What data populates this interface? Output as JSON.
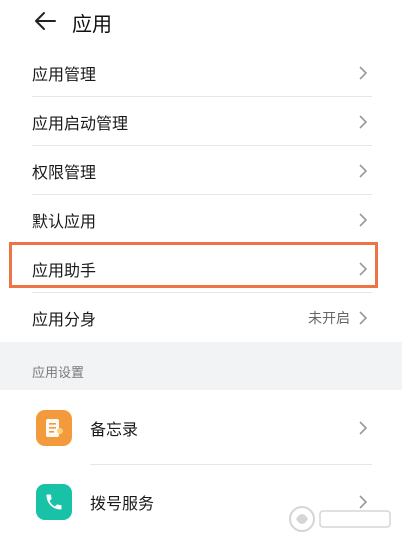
{
  "header": {
    "title": "应用",
    "back_icon": "arrow-left-icon"
  },
  "menu": {
    "items": [
      {
        "label": "应用管理",
        "value": ""
      },
      {
        "label": "应用启动管理",
        "value": ""
      },
      {
        "label": "权限管理",
        "value": ""
      },
      {
        "label": "默认应用",
        "value": ""
      },
      {
        "label": "应用助手",
        "value": "",
        "highlighted": true
      },
      {
        "label": "应用分身",
        "value": "未开启"
      }
    ]
  },
  "section": {
    "title": "应用设置"
  },
  "apps": [
    {
      "label": "备忘录",
      "icon": "memo-icon",
      "color": "#f39a3c"
    },
    {
      "label": "拨号服务",
      "icon": "phone-icon",
      "color": "#18c2a6"
    }
  ],
  "colors": {
    "highlight": "#ed7447",
    "background": "#f1f3f5"
  }
}
